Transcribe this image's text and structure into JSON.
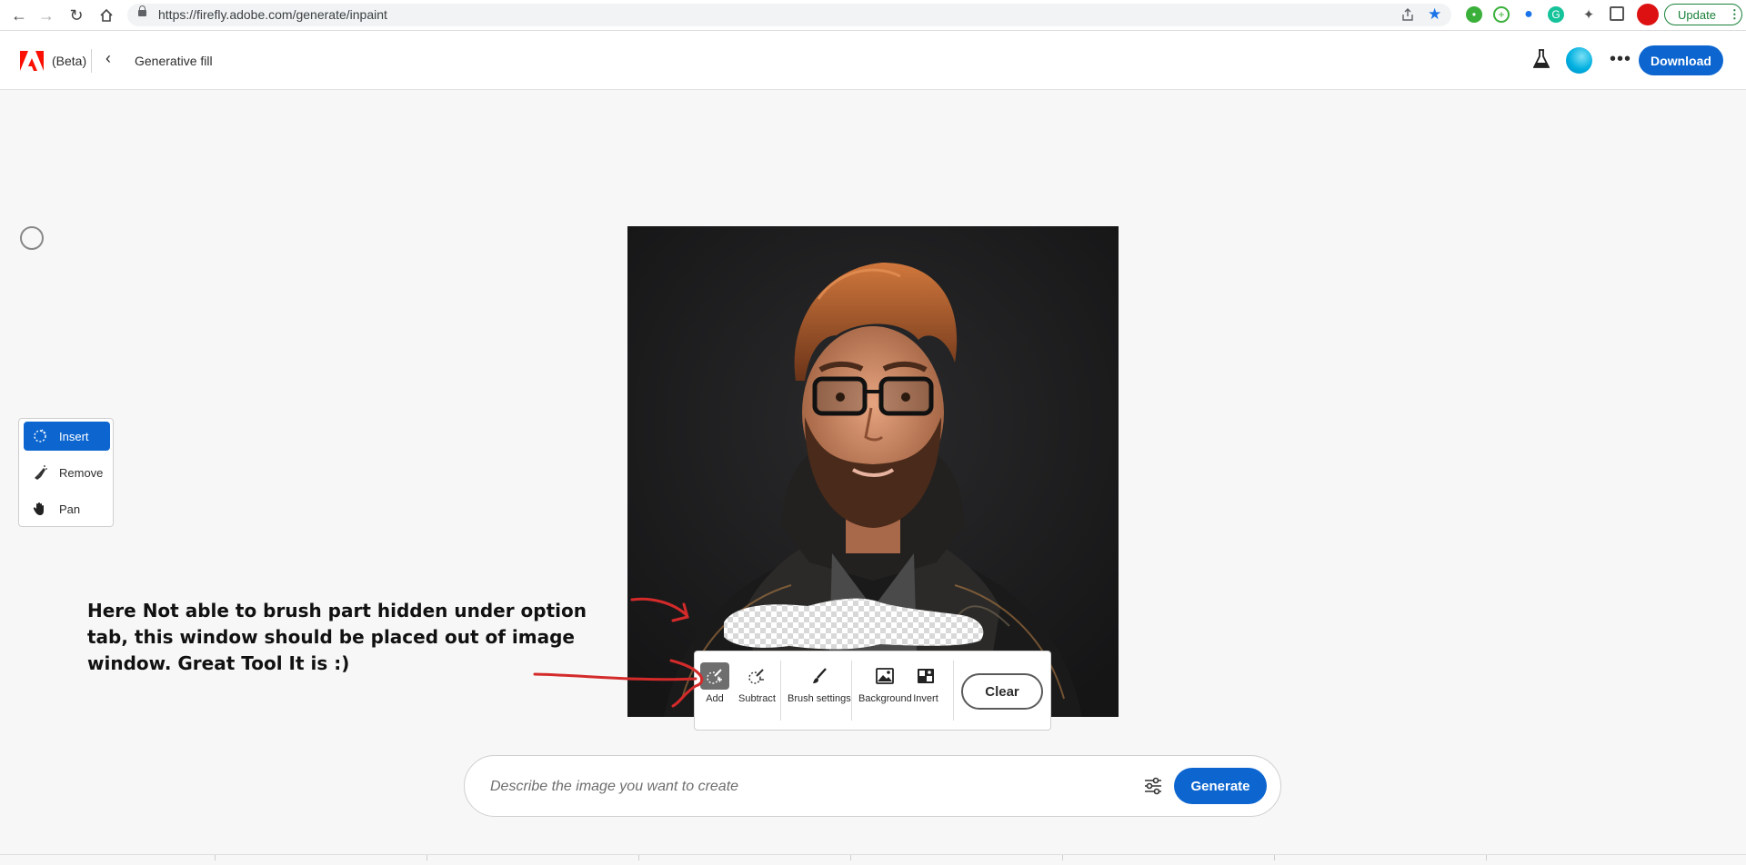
{
  "browser": {
    "url": "https://firefly.adobe.com/generate/inpaint",
    "update_label": "Update"
  },
  "header": {
    "beta_label": "(Beta)",
    "page_title": "Generative fill",
    "download_label": "Download"
  },
  "tools": {
    "items": [
      {
        "label": "Insert",
        "icon": "insert-brush-icon",
        "active": true
      },
      {
        "label": "Remove",
        "icon": "remove-brush-icon",
        "active": false
      },
      {
        "label": "Pan",
        "icon": "hand-icon",
        "active": false
      }
    ]
  },
  "brush_toolbar": {
    "add_label": "Add",
    "subtract_label": "Subtract",
    "brush_settings_label": "Brush settings",
    "background_label": "Background",
    "invert_label": "Invert",
    "clear_label": "Clear"
  },
  "prompt": {
    "placeholder": "Describe the image you want to create",
    "value": "",
    "generate_label": "Generate"
  },
  "annotation": {
    "text": "Here Not able to brush part hidden under option tab, this window should be placed out of image window.  Great Tool It is :)"
  },
  "colors": {
    "accent": "#0d66d0",
    "annotation_red": "#d42a2a"
  }
}
